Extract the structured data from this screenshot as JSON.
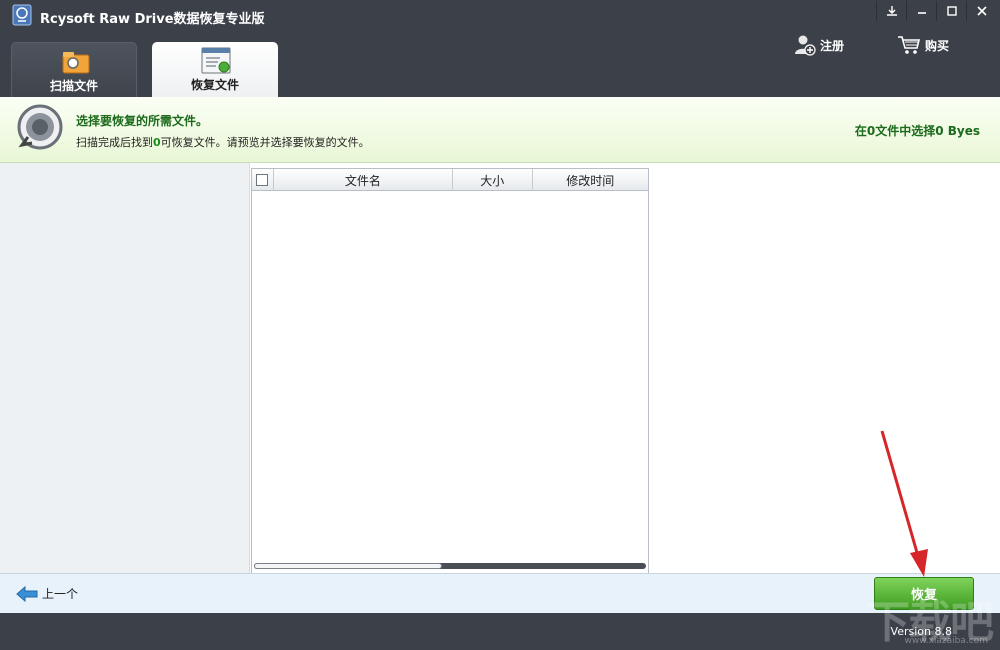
{
  "window": {
    "title": "Rcysoft Raw Drive数据恢复专业版"
  },
  "tabs": [
    {
      "label": "扫描文件",
      "icon": "folder-scan-icon",
      "active": false
    },
    {
      "label": "恢复文件",
      "icon": "recover-window-icon",
      "active": true
    }
  ],
  "header_actions": {
    "register_label": "注册",
    "buy_label": "购买"
  },
  "banner": {
    "title": "选择要恢复的所需文件。",
    "desc_before": "扫描完成后找到",
    "found_count": "0",
    "desc_after": "可恢复文件。请预览并选择要恢复的文件。",
    "selection_status": "在0文件中选择0 Byes"
  },
  "file_table": {
    "columns": [
      "文件名",
      "大小",
      "修改时间"
    ],
    "rows": [],
    "hscroll_fraction": 0.48
  },
  "bottom": {
    "prev_label": "上一个",
    "recover_label": "恢复"
  },
  "status": {
    "version": "Version 8.8"
  },
  "watermark": {
    "text": "下载吧",
    "sub": "www.xiazaiba.com"
  },
  "colors": {
    "accent_green": "#3f9c22",
    "banner_text": "#1c6a1c",
    "chrome_dark": "#3c4149"
  }
}
